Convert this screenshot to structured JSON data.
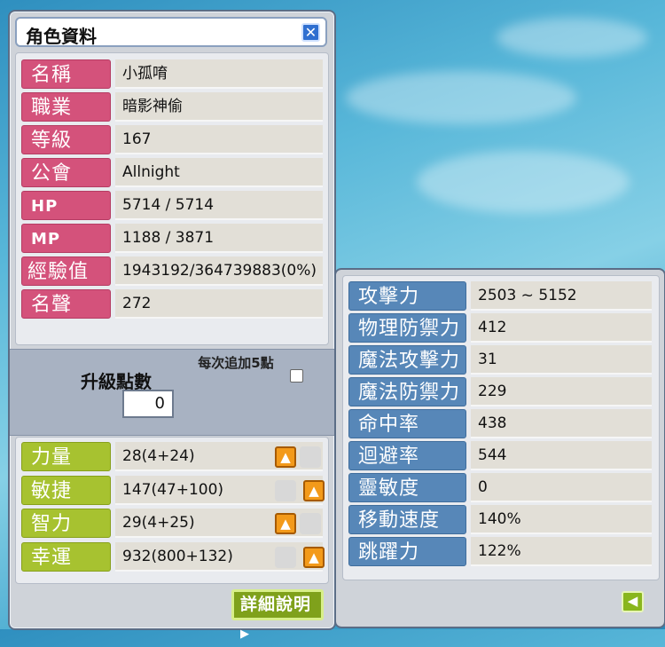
{
  "window_title": "角色資料",
  "info_rows": [
    {
      "label": "名稱",
      "value": "小孤唷"
    },
    {
      "label": "職業",
      "value": "暗影神偷"
    },
    {
      "label": "等級",
      "value": "167"
    },
    {
      "label": "公會",
      "value": "Allnight"
    },
    {
      "label": "HP",
      "value": "5714 / 5714"
    },
    {
      "label": "MP",
      "value": "1188 / 3871"
    },
    {
      "label": "經驗值",
      "value": "1943192/364739883(0%)"
    },
    {
      "label": "名聲",
      "value": "272"
    }
  ],
  "ap": {
    "label": "升級點數",
    "value": "0",
    "auto_label": "每次追加5點",
    "auto_checked": false
  },
  "stats": [
    {
      "label": "力量",
      "value": "28(4+24)"
    },
    {
      "label": "敏捷",
      "value": "147(47+100)"
    },
    {
      "label": "智力",
      "value": "29(4+25)"
    },
    {
      "label": "幸運",
      "value": "932(800+132)"
    }
  ],
  "detail_button": "詳細說明",
  "detail_rows": [
    {
      "label": "攻擊力",
      "value": "2503 ~ 5152"
    },
    {
      "label": "物理防禦力",
      "value": "412"
    },
    {
      "label": "魔法攻擊力",
      "value": "31"
    },
    {
      "label": "魔法防禦力",
      "value": "229"
    },
    {
      "label": "命中率",
      "value": "438"
    },
    {
      "label": "迴避率",
      "value": "544"
    },
    {
      "label": "靈敏度",
      "value": "0"
    },
    {
      "label": "移動速度",
      "value": "140%"
    },
    {
      "label": "跳躍力",
      "value": "122%"
    }
  ],
  "colors": {
    "label_pink": "#d4527b",
    "label_green": "#a7c230",
    "label_blue": "#5787b8",
    "up_arrow": "#f39a1a"
  }
}
